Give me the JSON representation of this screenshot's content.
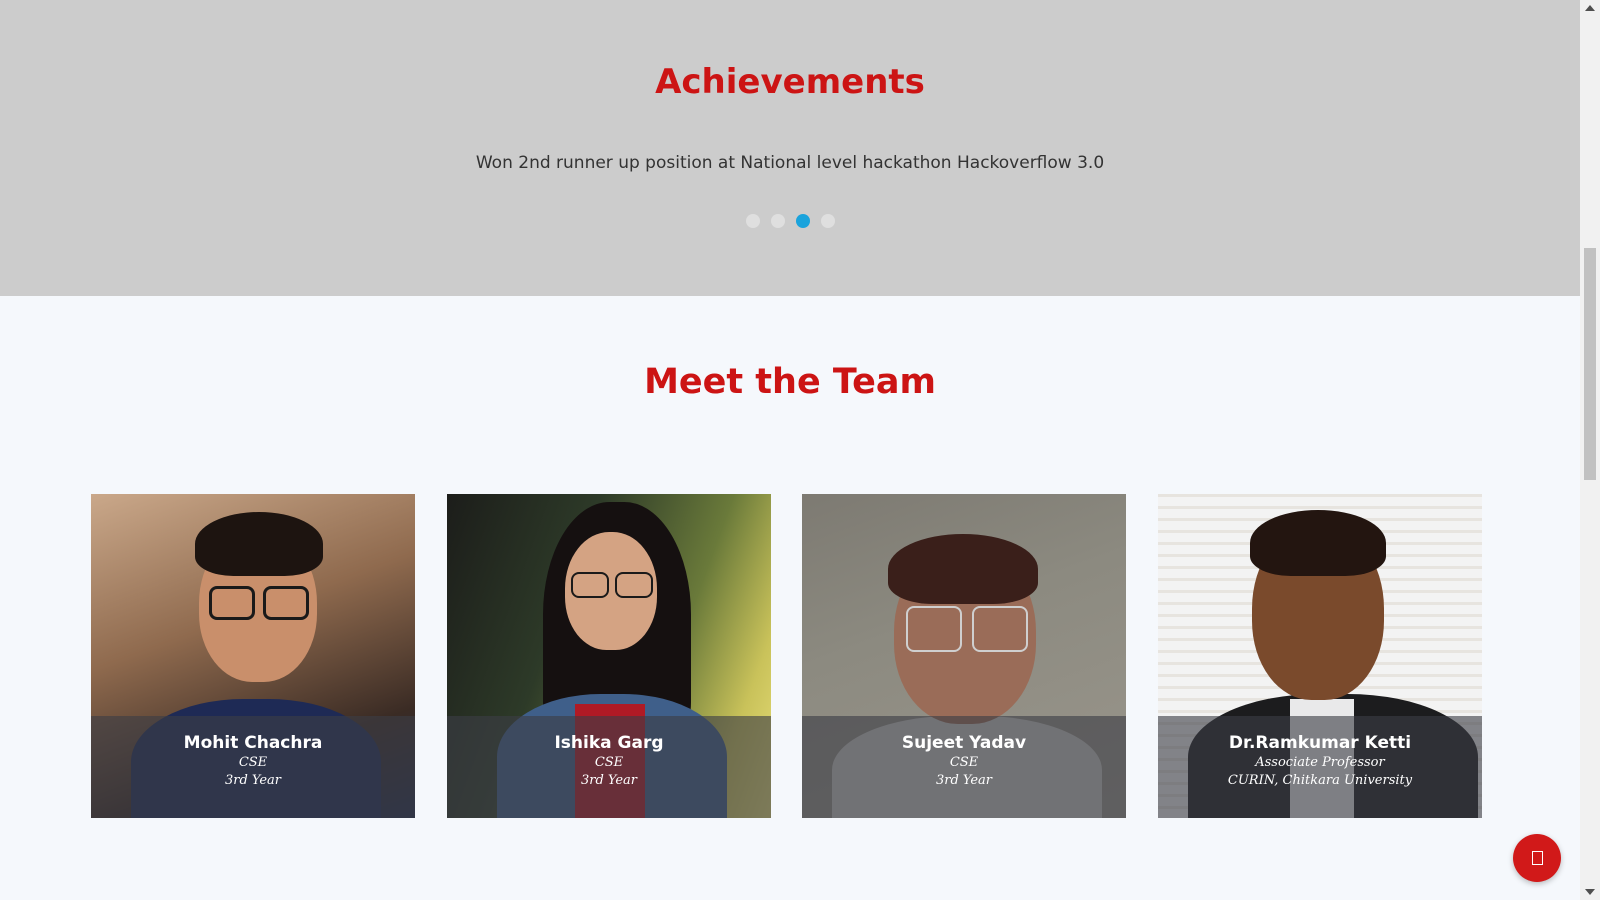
{
  "achievements": {
    "title": "Achievements",
    "text": "Won 2nd runner up position at National level hackathon Hackoverflow 3.0",
    "carousel": {
      "total": 4,
      "active_index": 2
    }
  },
  "team": {
    "title": "Meet the Team",
    "members": [
      {
        "name": "Mohit Chachra",
        "line1": "CSE",
        "line2": "3rd Year"
      },
      {
        "name": "Ishika Garg",
        "line1": "CSE",
        "line2": "3rd Year"
      },
      {
        "name": "Sujeet Yadav",
        "line1": "CSE",
        "line2": "3rd Year"
      },
      {
        "name": "Dr.Ramkumar Ketti",
        "line1": "Associate Professor",
        "line2": "CURIN, Chitkara University"
      }
    ]
  },
  "colors": {
    "accent": "#cc1414",
    "achievements_bg": "#cccccc",
    "page_bg": "#f5f8fc",
    "dot_active": "#1aa3dc",
    "dot_inactive": "#dfdfdf"
  },
  "icons": {
    "fab": "chat-icon"
  }
}
